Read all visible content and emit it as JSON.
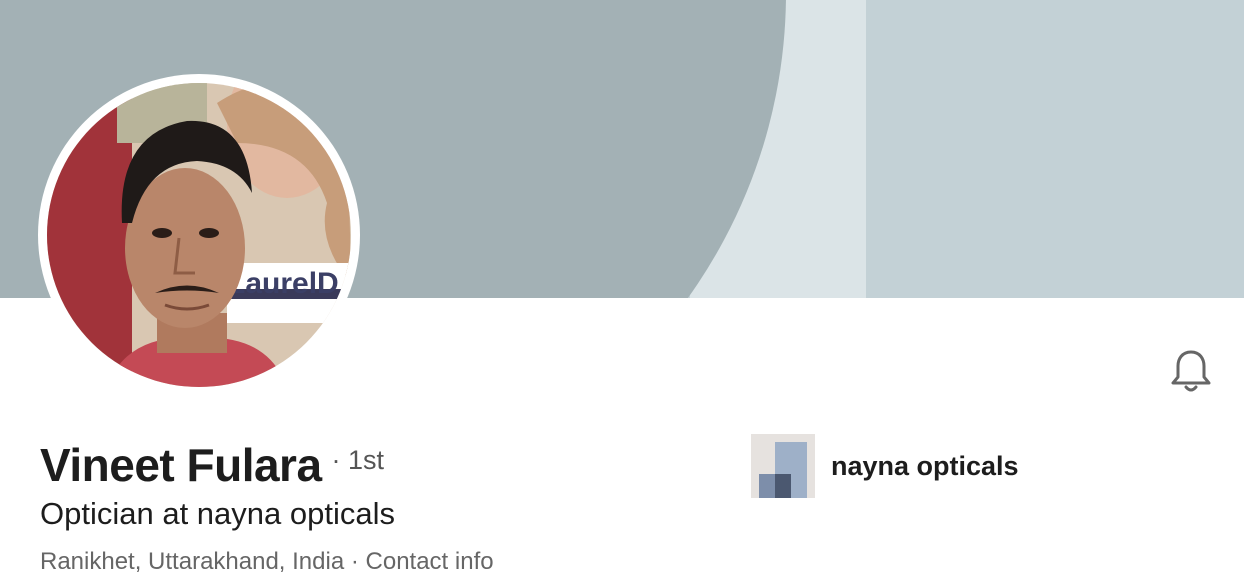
{
  "profile": {
    "name": "Vineet Fulara",
    "degree": "· 1st",
    "headline": "Optician at nayna opticals",
    "location_partial": "Ranikhet, Uttarakhand, India · Contact info"
  },
  "current_company": {
    "name": "nayna opticals"
  },
  "photo_sign_text": "LaurelD",
  "colors": {
    "banner_light": "#c3d1d6",
    "banner_dark": "#a3b1b5",
    "banner_stripe": "#dbe4e7",
    "text_primary": "#1d1d1d",
    "text_secondary": "#666666"
  },
  "icons": {
    "notifications": "bell-icon"
  }
}
